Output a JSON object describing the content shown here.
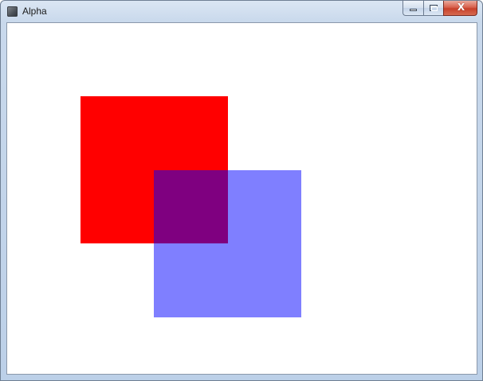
{
  "window": {
    "title": "Alpha",
    "icon": "app-icon",
    "caption_buttons": {
      "minimize_icon": "minimize-icon",
      "maximize_icon": "maximize-icon",
      "close_icon": "close-icon",
      "close_glyph": "X"
    }
  },
  "canvas": {
    "background": "#ffffff",
    "shapes": [
      {
        "name": "red-square",
        "color": "#ff0000",
        "opacity": 1.0
      },
      {
        "name": "blue-square",
        "color": "#0000ff",
        "opacity": 0.5
      }
    ]
  }
}
